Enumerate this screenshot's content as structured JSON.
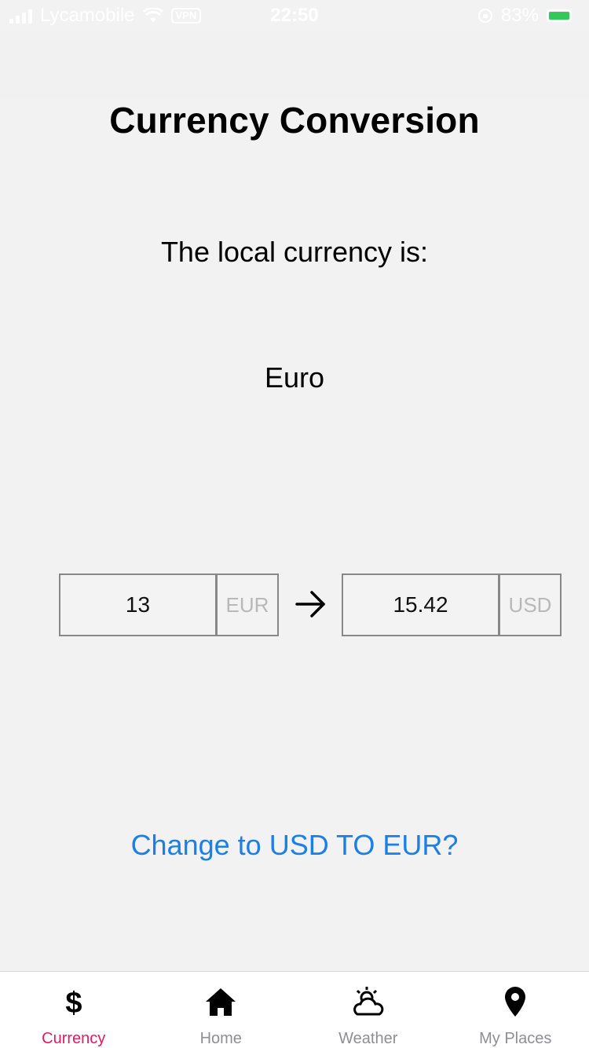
{
  "status_bar": {
    "carrier": "Lycamobile",
    "vpn": "VPN",
    "time": "22:50",
    "battery": "83%"
  },
  "page": {
    "title": "Currency Conversion",
    "local_label": "The local currency is:",
    "local_currency": "Euro"
  },
  "converter": {
    "from_amount": "13",
    "from_currency": "EUR",
    "to_amount": "15.42",
    "to_currency": "USD"
  },
  "change_link": "Change to USD TO EUR?",
  "tabs": [
    {
      "label": "Currency",
      "icon": "dollar-icon",
      "active": true
    },
    {
      "label": "Home",
      "icon": "home-icon",
      "active": false
    },
    {
      "label": "Weather",
      "icon": "weather-icon",
      "active": false
    },
    {
      "label": "My Places",
      "icon": "map-pin-icon",
      "active": false
    }
  ],
  "colors": {
    "accent": "#e5195f",
    "link": "#1a7fe6",
    "background": "#f2f2f2"
  }
}
